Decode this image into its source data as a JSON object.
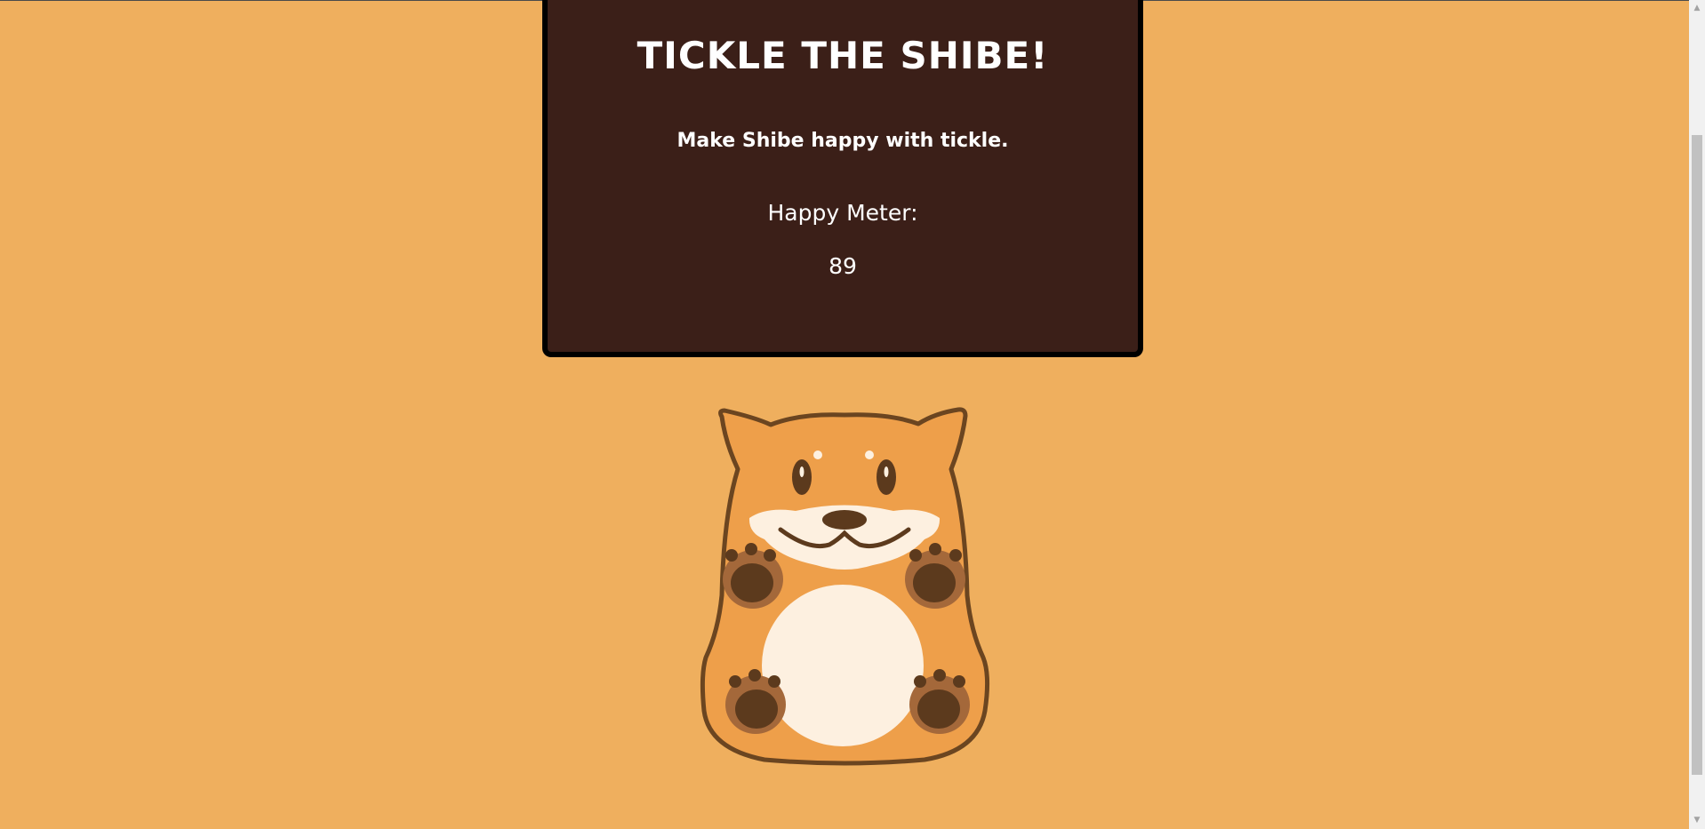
{
  "panel": {
    "title": "TICKLE THE SHIBE!",
    "subtitle": "Make Shibe happy with tickle.",
    "meter_label": "Happy Meter:",
    "meter_value": "89"
  },
  "shibe": {
    "icon": "shiba-dog-illustration"
  },
  "scrollbar": {
    "up_arrow": "▲",
    "down_arrow": "▼"
  },
  "colors": {
    "background": "#efaf5e",
    "panel": "#3b1f18",
    "panel_border": "#000000",
    "text": "#ffffff",
    "dog_body": "#ee9f4a",
    "dog_outline": "#6b4520",
    "dog_cream": "#fdf0e0",
    "paw_dark": "#5c3a1d",
    "paw_light": "#a4683a"
  }
}
